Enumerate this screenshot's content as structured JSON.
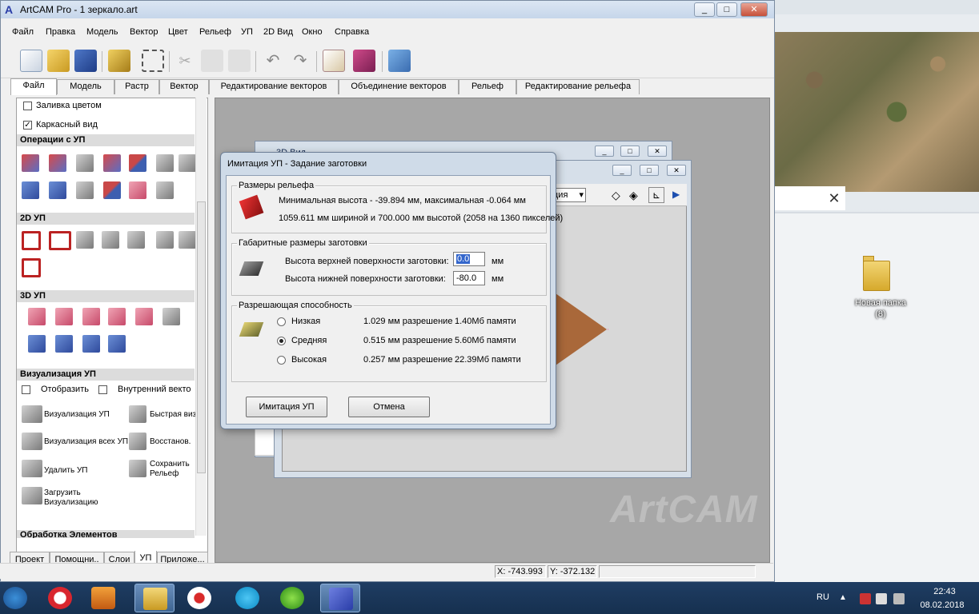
{
  "window": {
    "title": "ArtCAM Pro - 1 зеркало.art",
    "minimize": "_",
    "maximize": "□",
    "close": "✕"
  },
  "menu": [
    "Файл",
    "Правка",
    "Модель",
    "Вектор",
    "Цвет",
    "Рельеф",
    "УП",
    "2D Вид",
    "Окно",
    "Справка"
  ],
  "ribbon_tabs": [
    "Файл",
    "Модель",
    "Растр",
    "Вектор",
    "Редактирование векторов",
    "Объединение векторов",
    "Рельеф",
    "Редактирование рельефа"
  ],
  "left_panel": {
    "fill_color": "Заливка цветом",
    "wireframe": "Каркасный вид",
    "sections": {
      "toolpath_ops": "Операции с УП",
      "toolpath_2d": "2D УП",
      "toolpath_3d": "3D УП",
      "toolpath_vis": "Визуализация УП",
      "processing": "Обработка Элементов"
    },
    "show": "Отобразить",
    "inner_vectors": "Внутренний векто",
    "vis_items": [
      {
        "label": "Визуализация УП"
      },
      {
        "label": "Быстрая виз"
      },
      {
        "label": "Визуализация всех УП"
      },
      {
        "label": "Восстанов."
      },
      {
        "label": "Удалить УП"
      },
      {
        "label": "Сохранить Рельеф"
      },
      {
        "label": "Загрузить Визуализацию"
      }
    ],
    "tabs": [
      "Проект",
      "Помощни..",
      "Слои",
      "УП",
      "Приложе..."
    ]
  },
  "dialog": {
    "title": "Имитация УП - Задание заготовки",
    "relief_group": "Размеры рельефа",
    "relief_line1": "Минимальная высота - -39.894 мм, максимальная -0.064 мм",
    "relief_line2": "1059.611 мм шириной и 700.000 мм высотой (2058 на 1360 пикселей)",
    "block_group": "Габаритные размеры заготовки",
    "top_label": "Высота верхней поверхности заготовки:",
    "top_value": "0.0",
    "top_unit": "мм",
    "bottom_label": "Высота нижней поверхности заготовки:",
    "bottom_value": "-80.0",
    "bottom_unit": "мм",
    "res_group": "Разрешающая способность",
    "resolutions": [
      {
        "name": "Низкая",
        "res": "1.029 мм разрешение",
        "mem": "1.40Мб памяти",
        "selected": false
      },
      {
        "name": "Средняя",
        "res": "0.515 мм разрешение",
        "mem": "5.60Мб памяти",
        "selected": true
      },
      {
        "name": "Высокая",
        "res": "0.257 мм разрешение",
        "mem": "22.39Мб памяти",
        "selected": false
      }
    ],
    "ok": "Имитация УП",
    "cancel": "Отмена"
  },
  "child_window": {
    "title": "3D Вид",
    "view_dropdown": "ция"
  },
  "status": {
    "x": "X: -743.993",
    "y": "Y: -372.132"
  },
  "watermark": "ArtCAM",
  "desktop": {
    "folder_label": "Новая папка (8)"
  },
  "taskbar": {
    "lang": "RU",
    "time": "22:43",
    "date": "08.02.2018"
  },
  "colors": {
    "accent": "#2f5c8f",
    "dialog_frame": "#cfdbe8",
    "taskbar": "#1f3d63"
  }
}
